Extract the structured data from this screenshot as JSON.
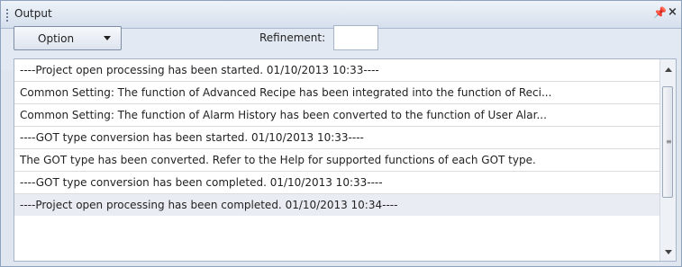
{
  "window": {
    "title": "Output",
    "pin_glyph": "2",
    "close_glyph": "×"
  },
  "toolbar": {
    "option_label": "Option",
    "refinement_label": "Refinement:",
    "refinement_value": ""
  },
  "output": {
    "lines": [
      "----Project open processing has been started.  01/10/2013 10:33----",
      "Common Setting: The function of Advanced Recipe has been integrated into the function of Reci...",
      "Common Setting: The function of Alarm History has been converted to the function of User Alar...",
      "----GOT type conversion has been started.  01/10/2013 10:33----",
      "The GOT type has been converted. Refer to the Help for supported functions of each GOT type.",
      "----GOT type conversion has been completed.  01/10/2013 10:33----",
      "----Project open processing has been completed.  01/10/2013 10:34----"
    ]
  },
  "scrollbar": {
    "thumb_grip": "≡"
  },
  "icons": {
    "pin": "pin-icon",
    "close": "close-icon",
    "dropdown": "chevron-down-icon"
  }
}
